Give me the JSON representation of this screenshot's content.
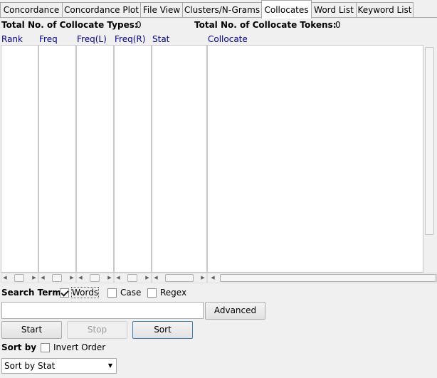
{
  "tabs": [
    {
      "label": "Concordance",
      "active": false
    },
    {
      "label": "Concordance Plot",
      "active": false
    },
    {
      "label": "File View",
      "active": false
    },
    {
      "label": "Clusters/N-Grams",
      "active": false
    },
    {
      "label": "Collocates",
      "active": true
    },
    {
      "label": "Word List",
      "active": false
    },
    {
      "label": "Keyword List",
      "active": false
    }
  ],
  "stats": {
    "types_label": "Total No. of Collocate Types:",
    "types_value": "0",
    "tokens_label": "Total No. of Collocate Tokens:",
    "tokens_value": "0"
  },
  "columns": [
    "Rank",
    "Freq",
    "Freq(L)",
    "Freq(R)",
    "Stat",
    "Collocate"
  ],
  "search": {
    "label": "Search Term",
    "words_label": "Words",
    "words_checked": true,
    "case_label": "Case",
    "case_checked": false,
    "regex_label": "Regex",
    "regex_checked": false,
    "input_value": "",
    "advanced_label": "Advanced"
  },
  "buttons": {
    "start": "Start",
    "stop": "Stop",
    "sort": "Sort"
  },
  "sort": {
    "label": "Sort by",
    "invert_label": "Invert Order",
    "invert_checked": false,
    "selected": "Sort by Stat"
  },
  "colors": {
    "header_text": "#000099",
    "pane_bg": "#ffffff",
    "window_bg": "#f0f0f0"
  }
}
